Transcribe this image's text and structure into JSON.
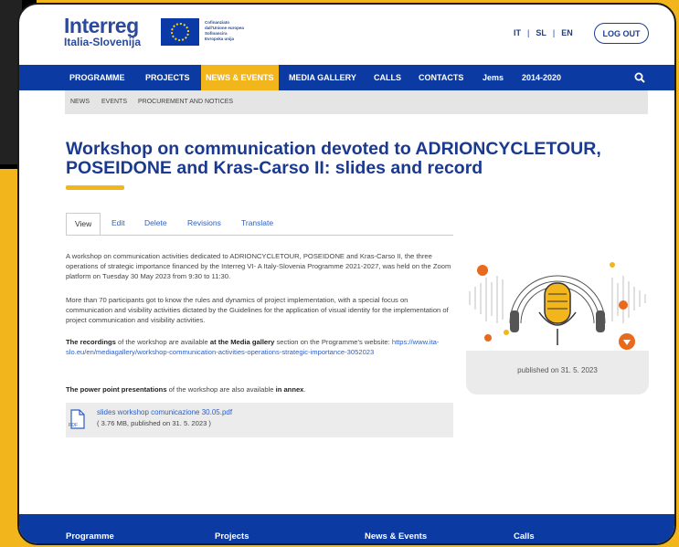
{
  "header": {
    "logo_main": "Interreg",
    "logo_sub": "Italia-Slovenija",
    "eu_lines": [
      "Cofinanziato",
      "dall'Unione europea",
      "Sofinancira",
      "Evropska unija"
    ],
    "languages": [
      "IT",
      "SL",
      "EN"
    ],
    "lang_separator": "|",
    "logout_label": "LOG OUT"
  },
  "nav": {
    "items": [
      "PROGRAMME",
      "PROJECTS",
      "NEWS & EVENTS",
      "MEDIA GALLERY",
      "CALLS",
      "CONTACTS",
      "Jems",
      "2014-2020"
    ],
    "active": "NEWS & EVENTS",
    "search_icon": "search-icon"
  },
  "subnav": {
    "items": [
      "NEWS",
      "EVENTS",
      "PROCUREMENT AND NOTICES"
    ]
  },
  "article": {
    "title": "Workshop on communication devoted to ADRIONCYCLETOUR, POSEIDONE and Kras-Carso II: slides and record",
    "tabs": [
      "View",
      "Edit",
      "Delete",
      "Revisions",
      "Translate"
    ],
    "active_tab": "View",
    "p1": "A workshop on communication activities dedicated to ADRIONCYCLETOUR, POSEIDONE and Kras-Carso II, the three operations of strategic importance financed by the Interreg VI- A Italy-Slovenia Programme 2021-2027, was held on the Zoom platform on Tuesday 30 May 2023 from 9:30 to 11:30.",
    "p2": "More than 70 participants got to know the rules and dynamics of project implementation, with a special focus on communication and visibility activities dictated by the Guidelines for the application of visual identity for the implementation of project communication and visibility activities.",
    "p3_bold1": "The recordings",
    "p3_mid": " of the workshop are available ",
    "p3_bold2": "at the Media gallery",
    "p3_end": " section on the Programme's website: ",
    "p3_link": "https://www.ita-slo.eu/en/mediagallery/workshop-communication-activities-operations-strategic-importance-3052023",
    "p4_bold1": "The power point presentations",
    "p4_mid": " of the workshop are also available ",
    "p4_bold2": "in annex",
    "p4_end": ".",
    "attachment": {
      "file_label": "PDF",
      "name": "slides workshop comunicazione 30.05.pdf",
      "meta": "( 3.76 MB, published on 31. 5. 2023 )"
    }
  },
  "card": {
    "image_icon": "microphone-headphones-icon",
    "caption": "published on 31. 5. 2023"
  },
  "footer": {
    "items": [
      "Programme",
      "Projects",
      "News & Events",
      "Calls"
    ]
  },
  "colors": {
    "brand_blue": "#0b3aa3",
    "accent_yellow": "#f2b51b",
    "link": "#2d5fc4"
  }
}
